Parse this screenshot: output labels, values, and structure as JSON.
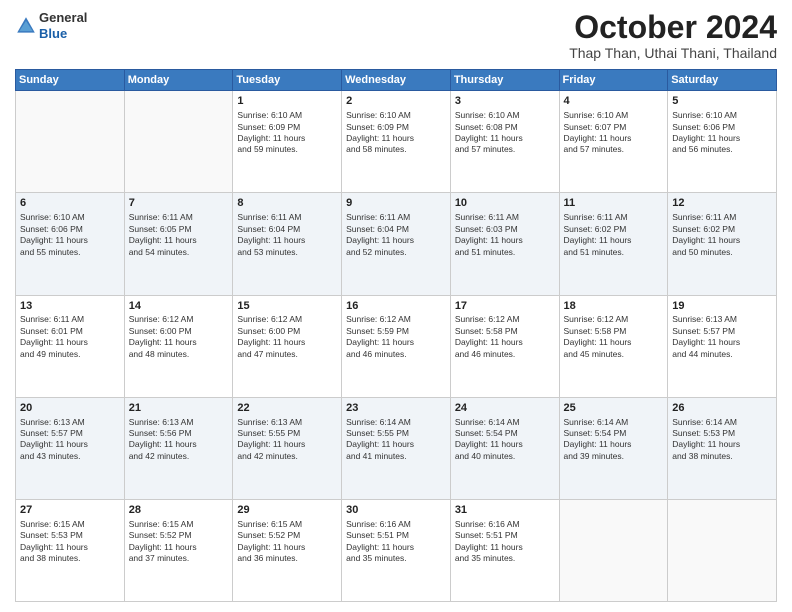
{
  "logo": {
    "general": "General",
    "blue": "Blue"
  },
  "header": {
    "month": "October 2024",
    "location": "Thap Than, Uthai Thani, Thailand"
  },
  "weekdays": [
    "Sunday",
    "Monday",
    "Tuesday",
    "Wednesday",
    "Thursday",
    "Friday",
    "Saturday"
  ],
  "weeks": [
    [
      {
        "day": "",
        "info": ""
      },
      {
        "day": "",
        "info": ""
      },
      {
        "day": "1",
        "info": "Sunrise: 6:10 AM\nSunset: 6:09 PM\nDaylight: 11 hours\nand 59 minutes."
      },
      {
        "day": "2",
        "info": "Sunrise: 6:10 AM\nSunset: 6:09 PM\nDaylight: 11 hours\nand 58 minutes."
      },
      {
        "day": "3",
        "info": "Sunrise: 6:10 AM\nSunset: 6:08 PM\nDaylight: 11 hours\nand 57 minutes."
      },
      {
        "day": "4",
        "info": "Sunrise: 6:10 AM\nSunset: 6:07 PM\nDaylight: 11 hours\nand 57 minutes."
      },
      {
        "day": "5",
        "info": "Sunrise: 6:10 AM\nSunset: 6:06 PM\nDaylight: 11 hours\nand 56 minutes."
      }
    ],
    [
      {
        "day": "6",
        "info": "Sunrise: 6:10 AM\nSunset: 6:06 PM\nDaylight: 11 hours\nand 55 minutes."
      },
      {
        "day": "7",
        "info": "Sunrise: 6:11 AM\nSunset: 6:05 PM\nDaylight: 11 hours\nand 54 minutes."
      },
      {
        "day": "8",
        "info": "Sunrise: 6:11 AM\nSunset: 6:04 PM\nDaylight: 11 hours\nand 53 minutes."
      },
      {
        "day": "9",
        "info": "Sunrise: 6:11 AM\nSunset: 6:04 PM\nDaylight: 11 hours\nand 52 minutes."
      },
      {
        "day": "10",
        "info": "Sunrise: 6:11 AM\nSunset: 6:03 PM\nDaylight: 11 hours\nand 51 minutes."
      },
      {
        "day": "11",
        "info": "Sunrise: 6:11 AM\nSunset: 6:02 PM\nDaylight: 11 hours\nand 51 minutes."
      },
      {
        "day": "12",
        "info": "Sunrise: 6:11 AM\nSunset: 6:02 PM\nDaylight: 11 hours\nand 50 minutes."
      }
    ],
    [
      {
        "day": "13",
        "info": "Sunrise: 6:11 AM\nSunset: 6:01 PM\nDaylight: 11 hours\nand 49 minutes."
      },
      {
        "day": "14",
        "info": "Sunrise: 6:12 AM\nSunset: 6:00 PM\nDaylight: 11 hours\nand 48 minutes."
      },
      {
        "day": "15",
        "info": "Sunrise: 6:12 AM\nSunset: 6:00 PM\nDaylight: 11 hours\nand 47 minutes."
      },
      {
        "day": "16",
        "info": "Sunrise: 6:12 AM\nSunset: 5:59 PM\nDaylight: 11 hours\nand 46 minutes."
      },
      {
        "day": "17",
        "info": "Sunrise: 6:12 AM\nSunset: 5:58 PM\nDaylight: 11 hours\nand 46 minutes."
      },
      {
        "day": "18",
        "info": "Sunrise: 6:12 AM\nSunset: 5:58 PM\nDaylight: 11 hours\nand 45 minutes."
      },
      {
        "day": "19",
        "info": "Sunrise: 6:13 AM\nSunset: 5:57 PM\nDaylight: 11 hours\nand 44 minutes."
      }
    ],
    [
      {
        "day": "20",
        "info": "Sunrise: 6:13 AM\nSunset: 5:57 PM\nDaylight: 11 hours\nand 43 minutes."
      },
      {
        "day": "21",
        "info": "Sunrise: 6:13 AM\nSunset: 5:56 PM\nDaylight: 11 hours\nand 42 minutes."
      },
      {
        "day": "22",
        "info": "Sunrise: 6:13 AM\nSunset: 5:55 PM\nDaylight: 11 hours\nand 42 minutes."
      },
      {
        "day": "23",
        "info": "Sunrise: 6:14 AM\nSunset: 5:55 PM\nDaylight: 11 hours\nand 41 minutes."
      },
      {
        "day": "24",
        "info": "Sunrise: 6:14 AM\nSunset: 5:54 PM\nDaylight: 11 hours\nand 40 minutes."
      },
      {
        "day": "25",
        "info": "Sunrise: 6:14 AM\nSunset: 5:54 PM\nDaylight: 11 hours\nand 39 minutes."
      },
      {
        "day": "26",
        "info": "Sunrise: 6:14 AM\nSunset: 5:53 PM\nDaylight: 11 hours\nand 38 minutes."
      }
    ],
    [
      {
        "day": "27",
        "info": "Sunrise: 6:15 AM\nSunset: 5:53 PM\nDaylight: 11 hours\nand 38 minutes."
      },
      {
        "day": "28",
        "info": "Sunrise: 6:15 AM\nSunset: 5:52 PM\nDaylight: 11 hours\nand 37 minutes."
      },
      {
        "day": "29",
        "info": "Sunrise: 6:15 AM\nSunset: 5:52 PM\nDaylight: 11 hours\nand 36 minutes."
      },
      {
        "day": "30",
        "info": "Sunrise: 6:16 AM\nSunset: 5:51 PM\nDaylight: 11 hours\nand 35 minutes."
      },
      {
        "day": "31",
        "info": "Sunrise: 6:16 AM\nSunset: 5:51 PM\nDaylight: 11 hours\nand 35 minutes."
      },
      {
        "day": "",
        "info": ""
      },
      {
        "day": "",
        "info": ""
      }
    ]
  ]
}
